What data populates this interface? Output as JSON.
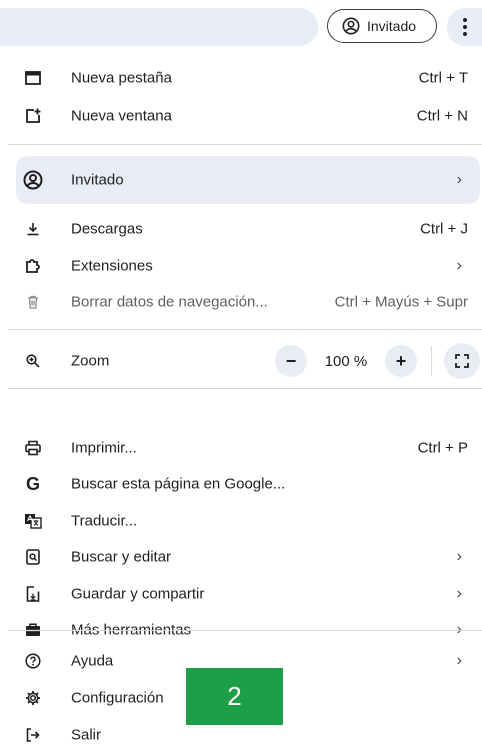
{
  "toolbar": {
    "profile_label": "Invitado",
    "profile_icon": "account-circle-icon",
    "menu_icon": "vertical-dots-icon"
  },
  "menu": {
    "new_tab": {
      "label": "Nueva pestaña",
      "shortcut": "Ctrl + T",
      "icon": "tab-icon"
    },
    "new_window": {
      "label": "Nueva ventana",
      "shortcut": "Ctrl + N",
      "icon": "new-window-icon"
    },
    "profile": {
      "label": "Invitado",
      "icon": "account-circle-icon"
    },
    "downloads": {
      "label": "Descargas",
      "shortcut": "Ctrl + J",
      "icon": "download-icon"
    },
    "extensions": {
      "label": "Extensiones",
      "icon": "puzzle-icon"
    },
    "clear_data": {
      "label": "Borrar datos de navegación...",
      "shortcut": "Ctrl + Mayús + Supr",
      "icon": "trash-icon"
    },
    "zoom": {
      "label": "Zoom",
      "value": "100 %",
      "minus": "−",
      "plus": "+",
      "icon": "zoom-icon"
    },
    "print": {
      "label": "Imprimir...",
      "shortcut": "Ctrl + P",
      "icon": "print-icon"
    },
    "search_google": {
      "label": "Buscar esta página en Google...",
      "icon": "google-g-icon",
      "glyph": "G"
    },
    "translate": {
      "label": "Traducir...",
      "icon": "translate-icon"
    },
    "find_edit": {
      "label": "Buscar y editar",
      "icon": "find-page-icon"
    },
    "save_share": {
      "label": "Guardar y compartir",
      "icon": "save-share-icon"
    },
    "more_tools": {
      "label": "Más herramientas",
      "icon": "toolbox-icon"
    },
    "help": {
      "label": "Ayuda",
      "icon": "help-icon"
    },
    "settings": {
      "label": "Configuración",
      "icon": "gear-icon"
    },
    "exit": {
      "label": "Salir",
      "icon": "exit-icon"
    },
    "submenu_chevron": "›"
  },
  "overlay": {
    "badge_text": "2",
    "badge_color": "#1f9e48"
  }
}
